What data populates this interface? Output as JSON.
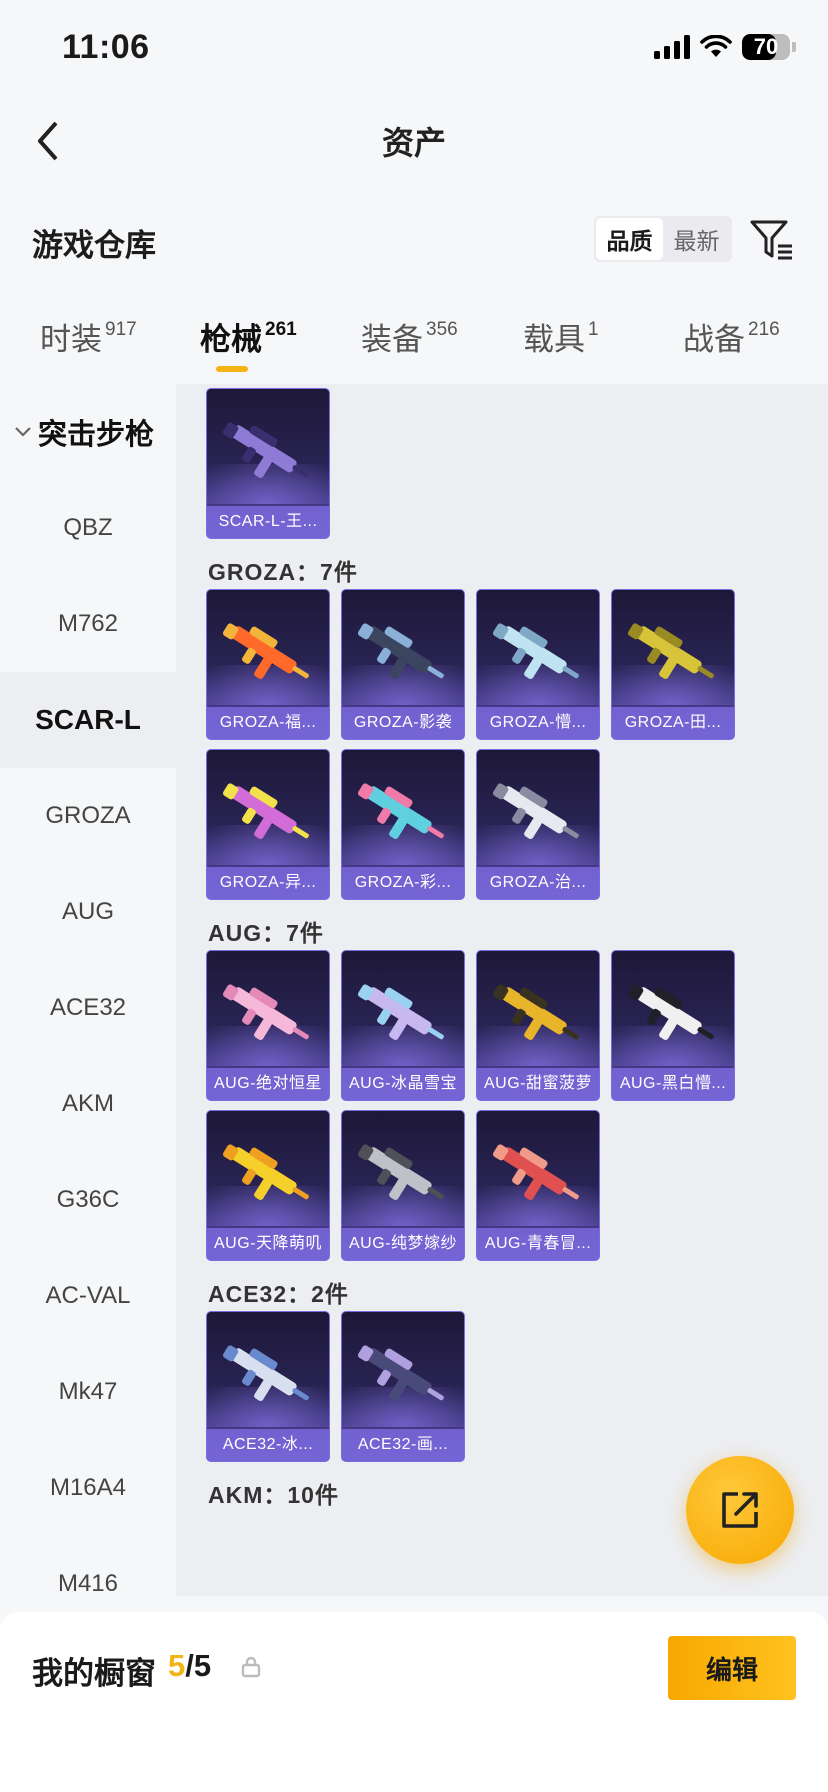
{
  "status": {
    "time": "11:06",
    "battery": "70",
    "battery_level": 0.7
  },
  "nav": {
    "title": "资产",
    "back_icon": "chevron-left-icon"
  },
  "section": {
    "title": "游戏仓库",
    "sort_options": [
      "品质",
      "最新"
    ],
    "sort_selected": "品质",
    "filter_icon": "filter-icon"
  },
  "tabs": [
    {
      "label": "时装",
      "count": "917",
      "active": false
    },
    {
      "label": "枪械",
      "count": "261",
      "active": true
    },
    {
      "label": "装备",
      "count": "356",
      "active": false
    },
    {
      "label": "载具",
      "count": "1",
      "active": false
    },
    {
      "label": "战备",
      "count": "216",
      "active": false
    }
  ],
  "sidebar": {
    "category": "突击步枪",
    "items": [
      "QBZ",
      "M762",
      "SCAR-L",
      "GROZA",
      "AUG",
      "ACE32",
      "AKM",
      "G36C",
      "AC-VAL",
      "Mk47",
      "M16A4",
      "M416"
    ],
    "active": "SCAR-L"
  },
  "groups": [
    {
      "label": "",
      "items": [
        "SCAR-L-王..."
      ]
    },
    {
      "label": "GROZA：7件",
      "items": [
        "GROZA-福...",
        "GROZA-影袭",
        "GROZA-懵...",
        "GROZA-田...",
        "GROZA-异...",
        "GROZA-彩...",
        "GROZA-治..."
      ]
    },
    {
      "label": "AUG：7件",
      "items": [
        "AUG-绝对恒星",
        "AUG-冰晶雪宝",
        "AUG-甜蜜菠萝",
        "AUG-黑白懵...",
        "AUG-天降萌叽",
        "AUG-纯梦嫁纱",
        "AUG-青春冒..."
      ]
    },
    {
      "label": "ACE32：2件",
      "items": [
        "ACE32-冰...",
        "ACE32-画..."
      ]
    },
    {
      "label": "AKM：10件",
      "items": []
    }
  ],
  "fab": {
    "icon": "share-external-icon"
  },
  "showcase": {
    "title": "我的橱窗",
    "current": "5",
    "separator": "/",
    "total": "5",
    "lock_icon": "lock-icon",
    "edit_label": "编辑"
  },
  "colors": {
    "accent": "#f5b416",
    "card_border": "#7a6be0",
    "card_label_bg": "#7a68dc"
  }
}
